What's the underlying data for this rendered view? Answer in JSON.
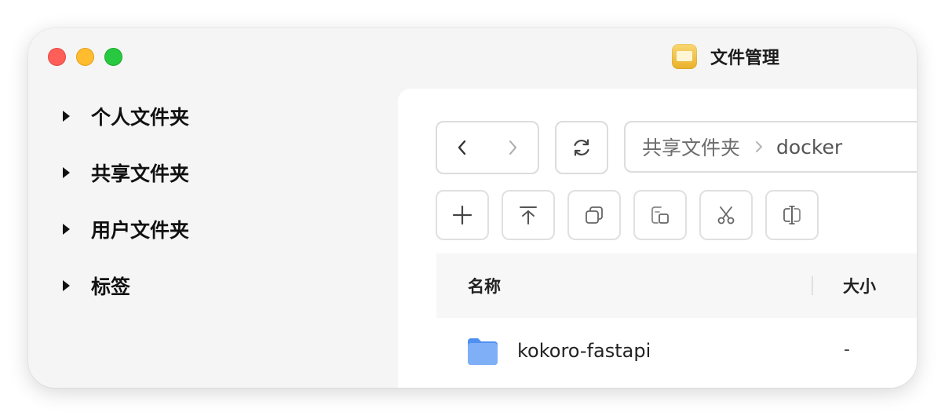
{
  "window": {
    "title": "文件管理"
  },
  "sidebar": {
    "items": [
      {
        "label": "个人文件夹"
      },
      {
        "label": "共享文件夹"
      },
      {
        "label": "用户文件夹"
      },
      {
        "label": "标签"
      }
    ]
  },
  "toolbar": {
    "icons": [
      "back-icon",
      "forward-icon",
      "refresh-icon",
      "plus-icon",
      "upload-icon",
      "copy-icon",
      "paste-icon",
      "scissors-icon",
      "rename-icon"
    ]
  },
  "breadcrumb": {
    "root": "共享文件夹",
    "current": "docker"
  },
  "table": {
    "columns": {
      "name": "名称",
      "size": "大小"
    },
    "rows": [
      {
        "name": "kokoro-fastapi",
        "size": "-"
      }
    ]
  },
  "colors": {
    "close": "#ff5f57",
    "minimize": "#febc2e",
    "maximize": "#28c840",
    "folder": "#6ea4f4"
  }
}
